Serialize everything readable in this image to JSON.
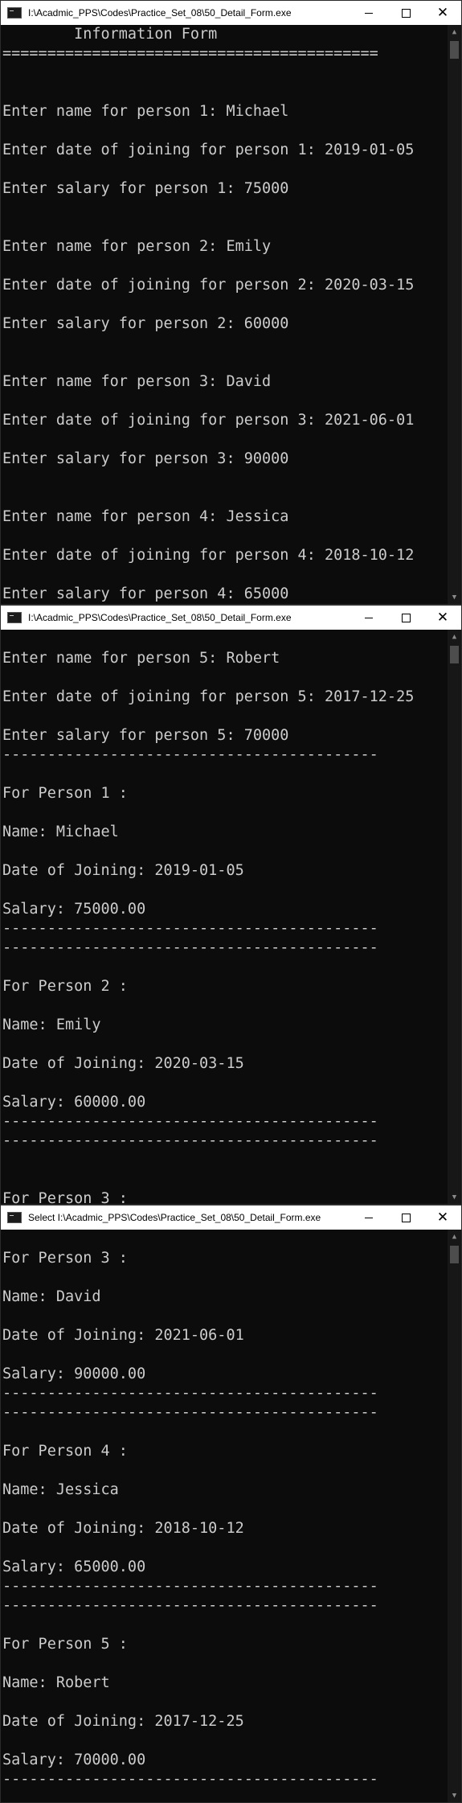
{
  "windows": [
    {
      "title": "I:\\Acadmic_PPS\\Codes\\Practice_Set_08\\50_Detail_Form.exe",
      "lines": [
        "        Information Form",
        "==========================================",
        "",
        "",
        "Enter name for person 1: Michael",
        "",
        "Enter date of joining for person 1: 2019-01-05",
        "",
        "Enter salary for person 1: 75000",
        "",
        "",
        "Enter name for person 2: Emily",
        "",
        "Enter date of joining for person 2: 2020-03-15",
        "",
        "Enter salary for person 2: 60000",
        "",
        "",
        "Enter name for person 3: David",
        "",
        "Enter date of joining for person 3: 2021-06-01",
        "",
        "Enter salary for person 3: 90000",
        "",
        "",
        "Enter name for person 4: Jessica",
        "",
        "Enter date of joining for person 4: 2018-10-12",
        "",
        "Enter salary for person 4: 65000"
      ]
    },
    {
      "title": "I:\\Acadmic_PPS\\Codes\\Practice_Set_08\\50_Detail_Form.exe",
      "lines": [
        "",
        "Enter name for person 5: Robert",
        "",
        "Enter date of joining for person 5: 2017-12-25",
        "",
        "Enter salary for person 5: 70000",
        "------------------------------------------",
        "",
        "For Person 1 :",
        "",
        "Name: Michael",
        "",
        "Date of Joining: 2019-01-05",
        "",
        "Salary: 75000.00",
        "------------------------------------------",
        "------------------------------------------",
        "",
        "For Person 2 :",
        "",
        "Name: Emily",
        "",
        "Date of Joining: 2020-03-15",
        "",
        "Salary: 60000.00",
        "------------------------------------------",
        "------------------------------------------",
        "",
        "",
        "For Person 3 :"
      ]
    },
    {
      "title": "Select I:\\Acadmic_PPS\\Codes\\Practice_Set_08\\50_Detail_Form.exe",
      "lines": [
        "",
        "For Person 3 :",
        "",
        "Name: David",
        "",
        "Date of Joining: 2021-06-01",
        "",
        "Salary: 90000.00",
        "------------------------------------------",
        "------------------------------------------",
        "",
        "For Person 4 :",
        "",
        "Name: Jessica",
        "",
        "Date of Joining: 2018-10-12",
        "",
        "Salary: 65000.00",
        "------------------------------------------",
        "------------------------------------------",
        "",
        "For Person 5 :",
        "",
        "Name: Robert",
        "",
        "Date of Joining: 2017-12-25",
        "",
        "Salary: 70000.00",
        "------------------------------------------"
      ]
    }
  ],
  "controls": {
    "minimize_icon": "minimize-icon",
    "maximize_icon": "maximize-icon",
    "close_icon": "close-icon",
    "close_glyph": "✕"
  },
  "scrollbar": {
    "up_glyph": "▲",
    "down_glyph": "▼"
  }
}
